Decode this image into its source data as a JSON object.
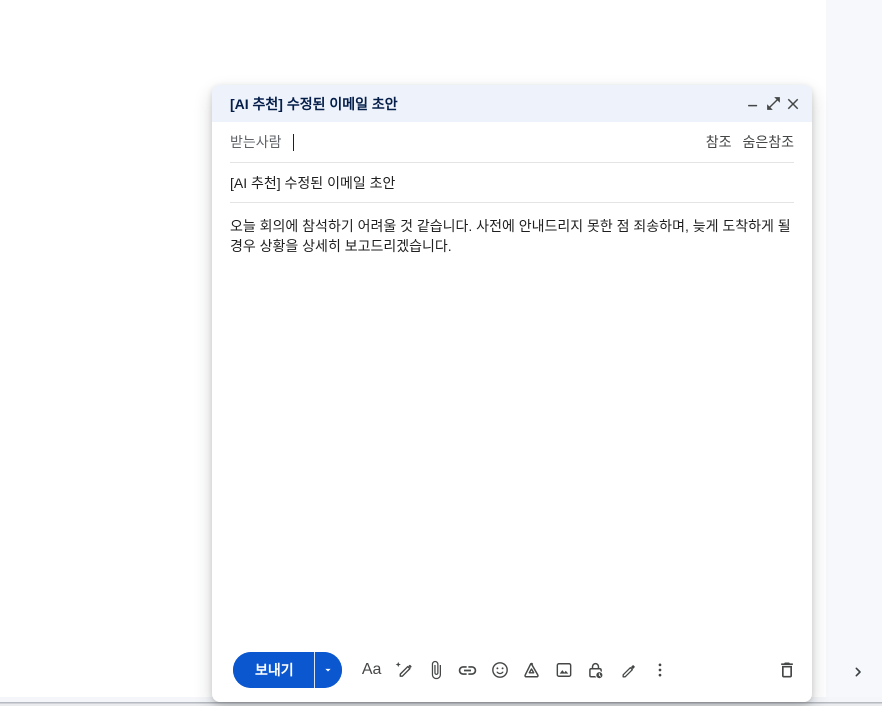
{
  "compose_window": {
    "title": "[AI 추천] 수정된 이메일 초안",
    "recipients": {
      "to_label": "받는사람",
      "to_value": "",
      "cc_label": "참조",
      "bcc_label": "숨은참조"
    },
    "subject": "[AI 추천] 수정된 이메일 초안",
    "body": "오늘 회의에 참석하기 어려울 것 같습니다. 사전에 안내드리지 못한 점 죄송하며, 늦게 도착하게 될 경우 상황을 상세히 보고드리겠습니다.",
    "toolbar": {
      "send_label": "보내기",
      "format_label": "Aa"
    }
  },
  "icons": {
    "minimize": "horizontal bar",
    "open_in_full": "diagonal expand arrows",
    "close": "X",
    "send_caret": "down triangle",
    "help_me_write": "pen with sparkle",
    "attach_file": "paperclip",
    "insert_link": "chain link",
    "insert_emoji": "smiley face",
    "insert_from_drive": "drive triangle",
    "insert_photo": "picture with mountain",
    "confidential_mode": "lock with clock badge",
    "insert_signature": "fountain pen",
    "more_options": "vertical three dots",
    "discard_draft": "trash can",
    "side_panel_chevron": "›"
  },
  "colors": {
    "accent_blue": "#0b57d0",
    "header_bg": "#eef2fb",
    "title_text": "#041e49",
    "icon_gray": "#444746",
    "side_rail_bg": "#f6f8fc",
    "divider": "#e4e4e6",
    "body_text": "#1f1f1f",
    "label_gray": "#5f6368"
  }
}
